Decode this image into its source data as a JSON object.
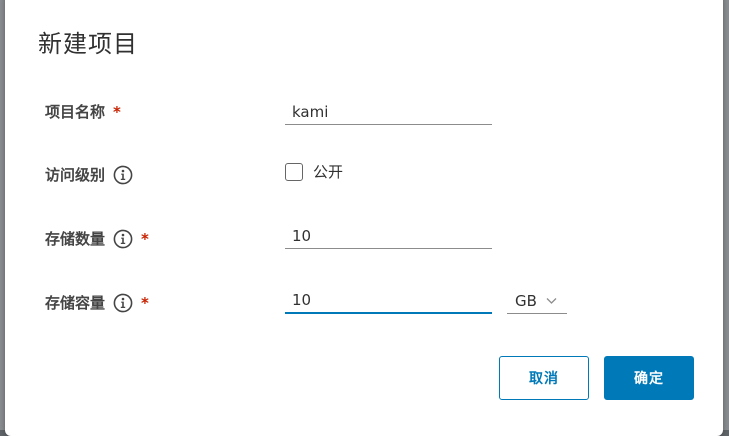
{
  "dialog": {
    "title": "新建项目"
  },
  "form": {
    "project_name": {
      "label": "项目名称",
      "required_mark": "*",
      "value": "kami"
    },
    "access_level": {
      "label": "访问级别",
      "info_icon": "info-icon",
      "checkbox_label": "公开",
      "checked": false
    },
    "storage_count": {
      "label": "存储数量",
      "info_icon": "info-icon",
      "required_mark": "*",
      "value": "10"
    },
    "storage_capacity": {
      "label": "存储容量",
      "info_icon": "info-icon",
      "required_mark": "*",
      "value": "10",
      "unit": "GB",
      "unit_icon": "chevron-down-icon"
    }
  },
  "actions": {
    "cancel_label": "取消",
    "ok_label": "确定"
  },
  "colors": {
    "accent": "#0079b8",
    "required": "#c92100"
  }
}
